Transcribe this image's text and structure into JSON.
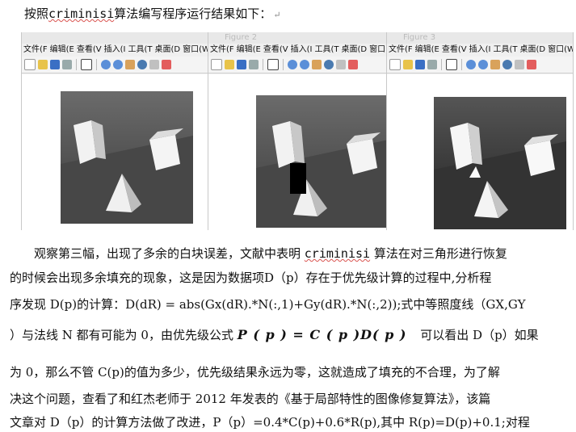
{
  "intro": {
    "prefix": "按照",
    "keyword": "criminisi",
    "suffix": "算法编写程序运行结果如下：",
    "mark": "↵"
  },
  "figures": [
    {
      "title": "",
      "menu": [
        "文件(F",
        "编辑(E",
        "查看(V",
        "插入(I",
        "工具(T",
        "桌面(D",
        "窗口(W"
      ]
    },
    {
      "title": "Figure 2",
      "menu": [
        "文件(F",
        "编辑(E",
        "查看(V",
        "插入(I",
        "工具(T",
        "桌面(D",
        "窗口(W"
      ]
    },
    {
      "title": "Figure 3",
      "menu": [
        "文件(F",
        "编辑(E",
        "查看(V",
        "插入(I",
        "工具(T",
        "桌面(D",
        "窗口(W"
      ]
    }
  ],
  "paragraph": {
    "l1a": "观察第三幅，出现了多余的白块误差，文献中表明 ",
    "l1kw": "criminisi",
    "l1b": " 算法在对三角形进行恢复",
    "l2": "的时候会出现多余填充的现象，这是因为数据项D（p）存在于优先级计算的过程中,分析程",
    "l3": "序发现 D(p)的计算：D(dR) = abs(Gx(dR).*N(:,1)+Gy(dR).*N(:,2));式中等照度线（GX,GY",
    "l4a": "）与法线 N 都有可能为 0，由优先级公式",
    "l4formula": "P ( p ) = C ( p )D( p )",
    "l4b": "可以看出 D（p）如果",
    "l5": "为 0，那么不管 C(p)的值为多少，优先级结果永远为零，这就造成了填充的不合理，为了解",
    "l6": "决这个问题，查看了和红杰老师于 2012 年发表的《基于局部特性的图像修复算法》，该篇",
    "l7": "文章对 D（p）的计算方法做了改进，P（p）=0.4*C(p)+0.6*R(p),其中 R(p)=D(p)+0.1;对程"
  }
}
